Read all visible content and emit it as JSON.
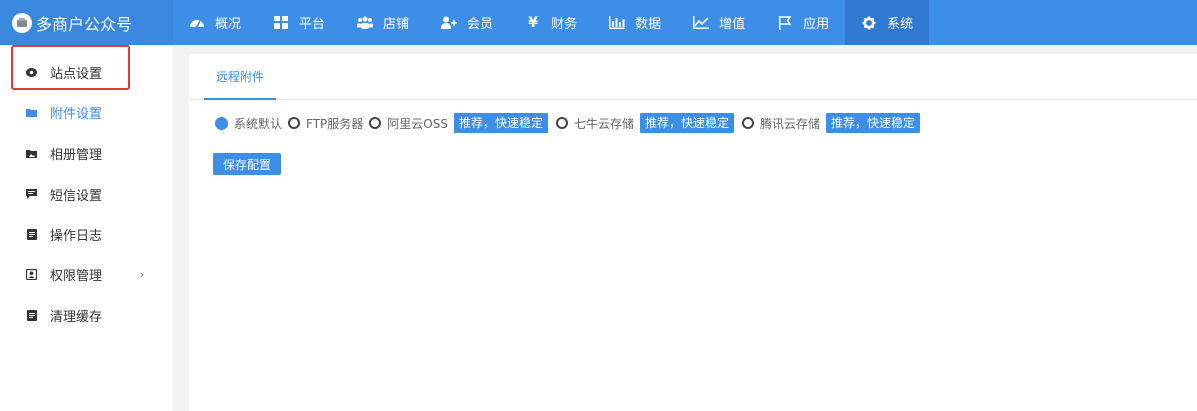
{
  "app": {
    "title": "多商户公众号"
  },
  "topnav": {
    "items": [
      {
        "label": "概况",
        "icon": "dashboard-icon"
      },
      {
        "label": "平台",
        "icon": "grid-icon"
      },
      {
        "label": "店铺",
        "icon": "group-icon"
      },
      {
        "label": "会员",
        "icon": "add-user-icon"
      },
      {
        "label": "财务",
        "icon": "yen-icon"
      },
      {
        "label": "数据",
        "icon": "bar-chart-icon"
      },
      {
        "label": "增值",
        "icon": "line-chart-icon"
      },
      {
        "label": "应用",
        "icon": "flag-icon"
      },
      {
        "label": "系统",
        "icon": "gear-icon"
      }
    ],
    "active": "系统",
    "yen_glyph": "¥"
  },
  "sidebar": {
    "items": [
      {
        "label": "站点设置",
        "icon": "eye-icon"
      },
      {
        "label": "附件设置",
        "icon": "folder-icon"
      },
      {
        "label": "相册管理",
        "icon": "image-folder-icon"
      },
      {
        "label": "短信设置",
        "icon": "message-icon"
      },
      {
        "label": "操作日志",
        "icon": "document-icon"
      },
      {
        "label": "权限管理",
        "icon": "user-card-icon",
        "chevron": "›"
      },
      {
        "label": "清理缓存",
        "icon": "document-icon"
      }
    ],
    "active": "附件设置"
  },
  "main": {
    "tab": "远程附件",
    "storage_options": [
      {
        "label": "系统默认",
        "checked": true
      },
      {
        "label": "FTP服务器",
        "checked": false
      },
      {
        "label": "阿里云OSS",
        "checked": false,
        "badge": "推荐，快速稳定"
      },
      {
        "label": "七牛云存储",
        "checked": false,
        "badge": "推荐，快速稳定"
      },
      {
        "label": "腾讯云存储",
        "checked": false,
        "badge": "推荐，快速稳定"
      }
    ],
    "save_label": "保存配置"
  },
  "colors": {
    "primary": "#3d8ee6",
    "highlight": "#e53935"
  }
}
